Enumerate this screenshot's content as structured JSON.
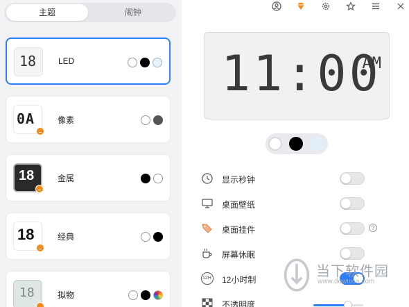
{
  "tabs": {
    "theme": "主题",
    "alarm": "闹钟"
  },
  "themes": [
    {
      "name": "LED",
      "colors": [
        "white",
        "black",
        "light"
      ]
    },
    {
      "name": "像素",
      "colors": [
        "white",
        "gray"
      ]
    },
    {
      "name": "金属",
      "colors": [
        "black",
        "white"
      ]
    },
    {
      "name": "经典",
      "colors": [
        "white",
        "black"
      ]
    },
    {
      "name": "拟物",
      "colors": [
        "white",
        "black",
        "rainbow"
      ]
    }
  ],
  "thumbs": {
    "led": "18",
    "pixel": "0A",
    "metal": "18",
    "classic": "18",
    "skeuo": "18"
  },
  "topbar_icons": [
    "user-icon",
    "diamond-icon",
    "gear-icon",
    "star-icon",
    "menu-icon",
    "close-icon"
  ],
  "clock": {
    "time": "11:00",
    "ampm": "AM"
  },
  "settings": {
    "show_seconds": "显示秒钟",
    "desktop_wallpaper": "桌面壁纸",
    "desktop_widget": "桌面挂件",
    "screen_sleep": "屏幕休眠",
    "hour12": "12小时制",
    "hour12_icon": "12H",
    "opacity": "不透明度"
  },
  "toggles": {
    "show_seconds": false,
    "desktop_wallpaper": false,
    "desktop_widget": false,
    "screen_sleep": false,
    "hour12": true
  },
  "opacity_value": 0.7,
  "watermark": {
    "text": "当下软件园",
    "url": "www.downxia.com"
  },
  "colors": {
    "accent": "#2e7ef7",
    "badge": "#f08c1a",
    "panel": "#f2f3f5"
  }
}
